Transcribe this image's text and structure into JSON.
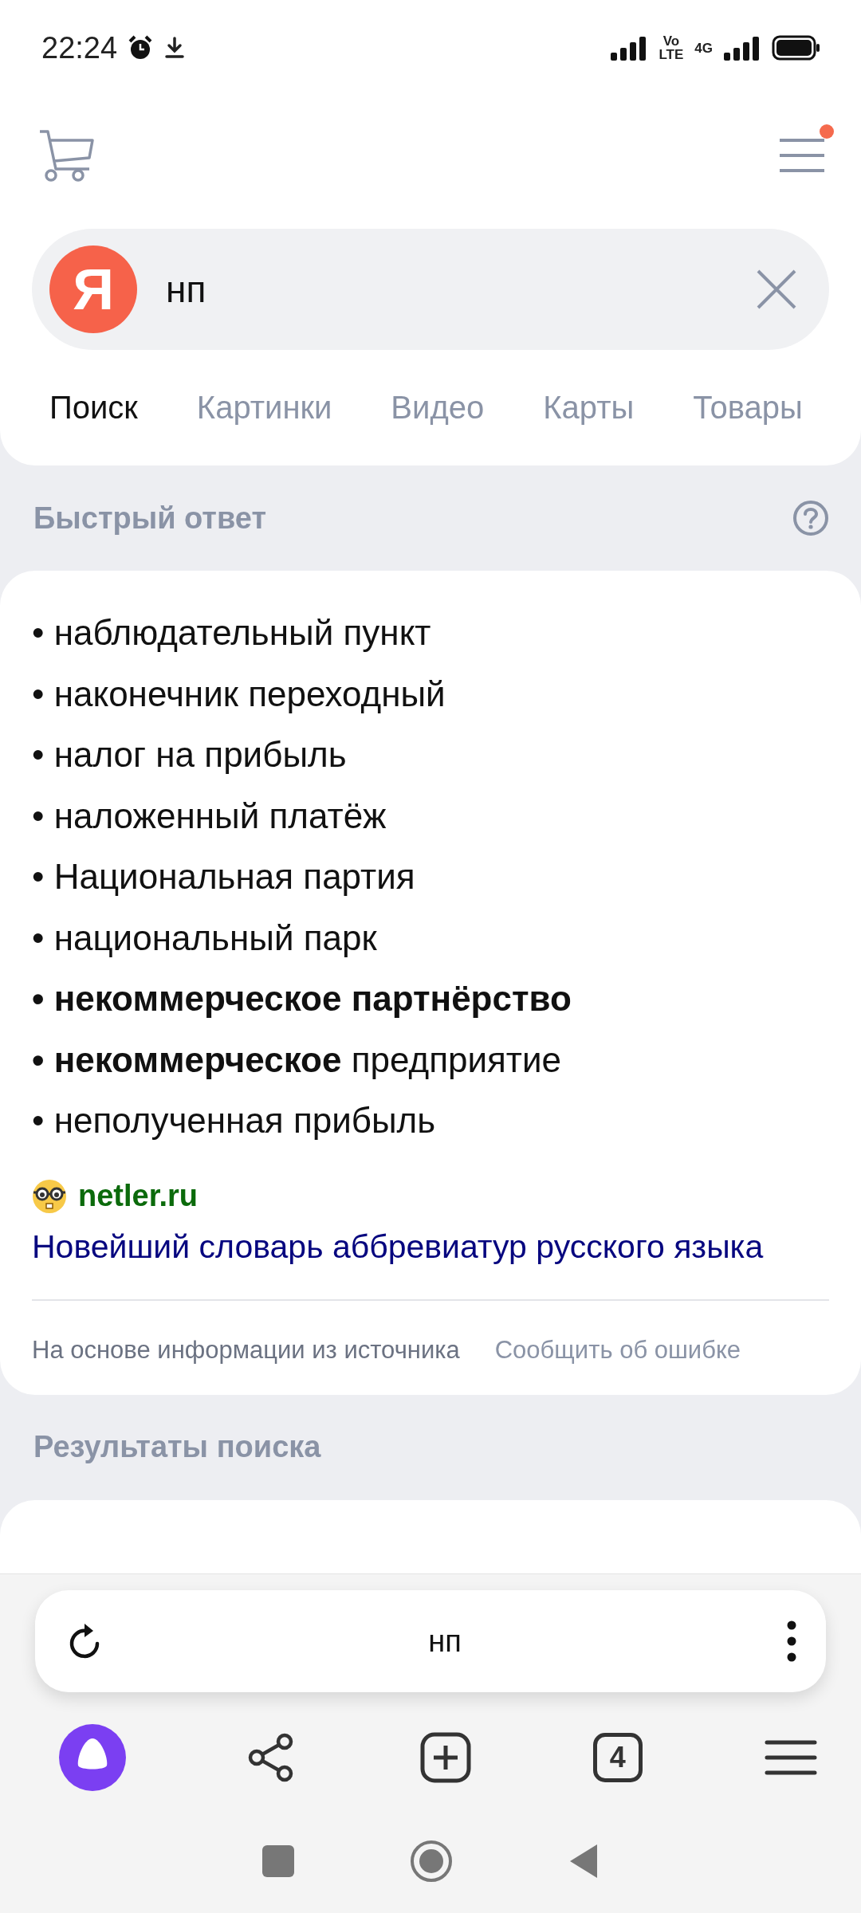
{
  "status_bar": {
    "time": "22:24",
    "volte_top": "Vo",
    "volte_bottom": "LTE",
    "network": "4G"
  },
  "header": {
    "menu_badge": true
  },
  "search": {
    "logo": "Я",
    "value": "нп"
  },
  "tabs": [
    {
      "label": "Поиск",
      "selected": true
    },
    {
      "label": "Картинки",
      "selected": false
    },
    {
      "label": "Видео",
      "selected": false
    },
    {
      "label": "Карты",
      "selected": false
    },
    {
      "label": "Товары",
      "selected": false
    }
  ],
  "quick_answer": {
    "heading": "Быстрый ответ",
    "items": [
      "• наблюдательный пункт",
      "• наконечник переходный",
      "• налог на прибыль",
      "• наложенный платёж",
      "• Национальная партия",
      "• национальный парк",
      "**• некоммерческое партнёрство**",
      "**• некоммерческое** предприятие",
      "• неполученная прибыль"
    ],
    "source_site": "netler.ru",
    "source_title": "Новейший словарь аббревиатур русского языка",
    "footer_note": "На основе информации из источника",
    "report_link": "Сообщить об ошибке"
  },
  "results": {
    "heading": "Результаты поиска"
  },
  "address_bar": {
    "query": "нп"
  },
  "toolbar": {
    "tab_count": "4"
  }
}
